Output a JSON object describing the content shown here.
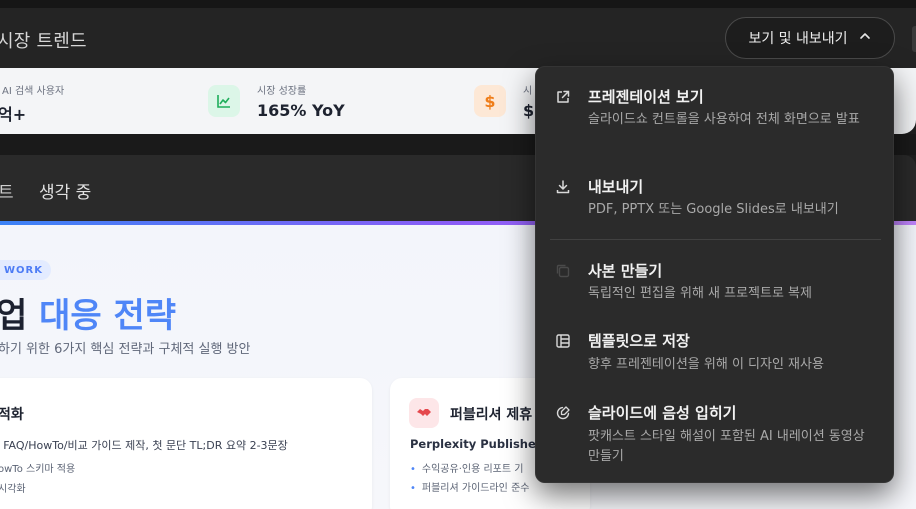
{
  "header": {
    "title": "시장 트렌드",
    "view_export_label": "보기 및 내보내기"
  },
  "stats": [
    {
      "label": "AI 검색 사용자",
      "value": "억+"
    },
    {
      "label": "시장 성장률",
      "value": "165% YoY",
      "icon": "chart-up-icon",
      "color": "#1fae5b"
    },
    {
      "label": "시",
      "value": "$5",
      "icon": "dollar-icon",
      "icon_text": "$",
      "color": "#ef7d19"
    }
  ],
  "tabs": [
    {
      "label": "트"
    },
    {
      "label": "생각 중"
    }
  ],
  "slide": {
    "badge": "WORK",
    "headline_dark": "업 ",
    "headline_accent": "대응 전략",
    "subtitle": "하기 위한 6가지 핵심 전략과 구체적 실행 방안",
    "card_left": {
      "title": "적화",
      "line1": ": FAQ/HowTo/비교 가이드 제작, 첫 문단 TL;DR 요약 2-3문장",
      "line2": "owTo 스키마 적용",
      "line3": "시각화"
    },
    "card_right": {
      "title": "퍼블리셔 제휴",
      "subtitle": "Perplexity Publishers",
      "bullet1": "수익공유·인용 리포트 기",
      "bullet2": "퍼블리셔 가이드라인 준수"
    }
  },
  "menu": {
    "items": [
      {
        "title": "프레젠테이션 보기",
        "desc": "슬라이드쇼 컨트롤을 사용하여 전체 화면으로 발표",
        "icon": "external-link-icon"
      },
      {
        "title": "내보내기",
        "desc": "PDF, PPTX 또는 Google Slides로 내보내기",
        "icon": "download-icon"
      },
      {
        "title": "사본 만들기",
        "desc": "독립적인 편집을 위해 새 프로젝트로 복제",
        "icon": "copy-icon"
      },
      {
        "title": "템플릿으로 저장",
        "desc": "향후 프레젠테이션을 위해 이 디자인 재사용",
        "icon": "template-icon"
      },
      {
        "title": "슬라이드에 음성 입히기",
        "desc": "팟캐스트 스타일 해설이 포함된 AI 내레이션 동영상 만들기",
        "icon": "voice-edit-icon"
      }
    ]
  },
  "colors": {
    "accent": "#4f86f7",
    "menu_bg": "#2b2b2b",
    "header_bg": "#242424"
  }
}
